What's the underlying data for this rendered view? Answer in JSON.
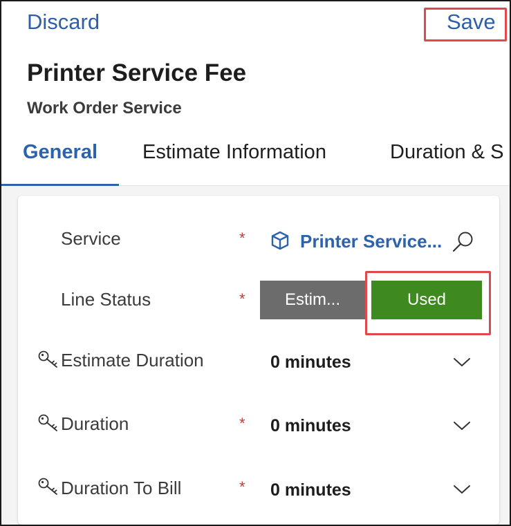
{
  "header": {
    "discard_label": "Discard",
    "save_label": "Save",
    "title": "Printer Service Fee",
    "subtitle": "Work Order Service"
  },
  "tabs": [
    {
      "label": "General",
      "active": true
    },
    {
      "label": "Estimate Information",
      "active": false
    },
    {
      "label": "Duration & S",
      "active": false
    }
  ],
  "form": {
    "service": {
      "label": "Service",
      "required": "*",
      "value": "Printer Service...",
      "icon": "cube-icon",
      "lookup_icon": "search-icon"
    },
    "line_status": {
      "label": "Line Status",
      "required": "*",
      "options": [
        "Estim...",
        "Used"
      ],
      "selected": "Used"
    },
    "estimate_duration": {
      "label": "Estimate Duration",
      "value": "0 minutes",
      "icon": "key-icon"
    },
    "duration": {
      "label": "Duration",
      "required": "*",
      "value": "0 minutes",
      "icon": "key-icon"
    },
    "duration_to_bill": {
      "label": "Duration To Bill",
      "required": "*",
      "value": "0 minutes",
      "icon": "key-icon"
    }
  },
  "colors": {
    "link": "#2d5fa8",
    "active_tab": "#2d62ad",
    "used_button": "#3e8a1e",
    "estimated_button": "#6c6c6c",
    "required": "#c43a3a",
    "callout": "#e0484b"
  }
}
